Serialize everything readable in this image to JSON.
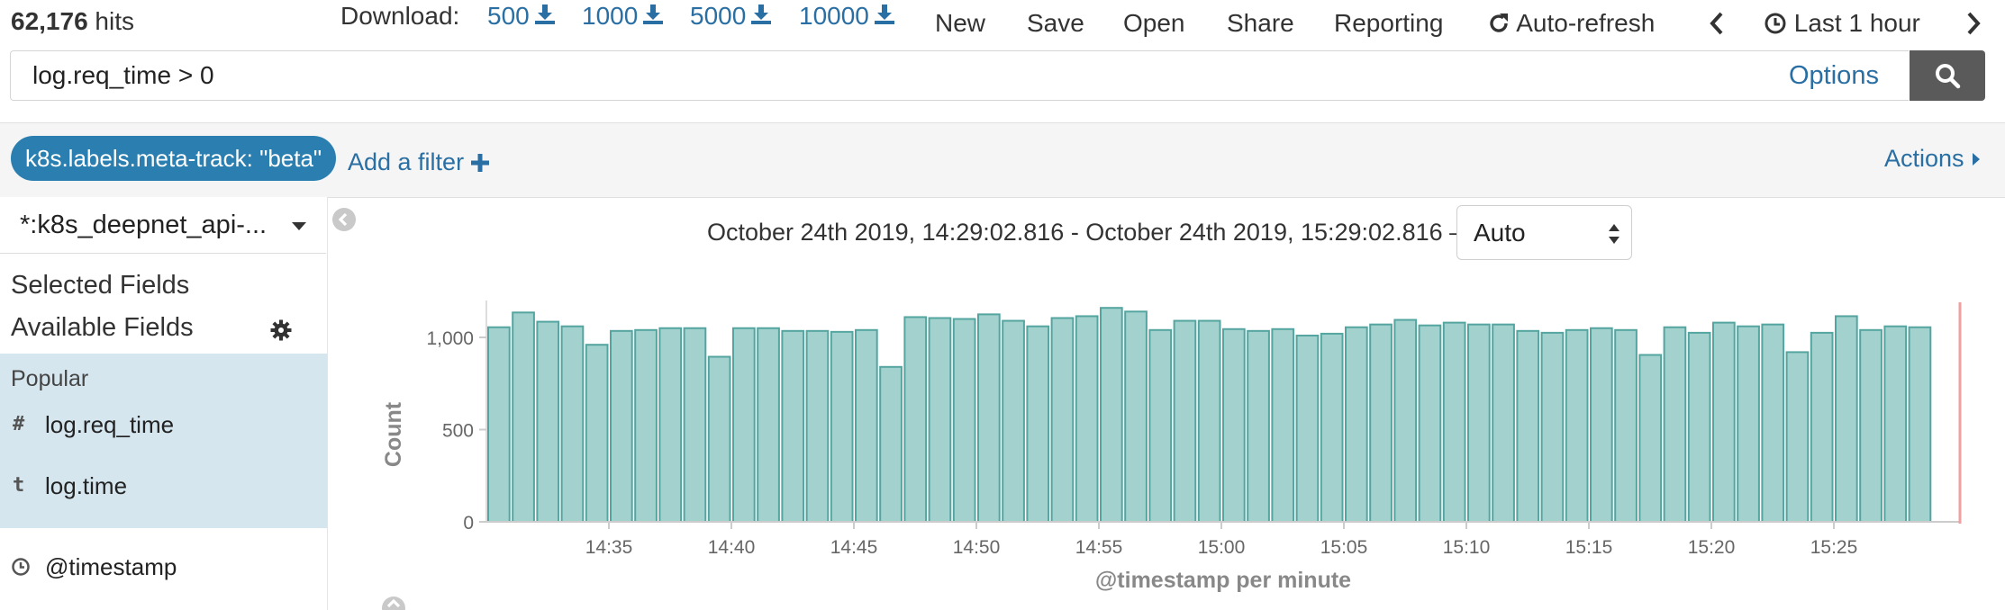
{
  "header": {
    "hits_count": "62,176",
    "hits_label": "hits",
    "download_label": "Download:",
    "download_options": [
      "500",
      "1000",
      "5000",
      "10000"
    ],
    "menu": {
      "new": "New",
      "save": "Save",
      "open": "Open",
      "share": "Share",
      "reporting": "Reporting",
      "auto_refresh": "Auto-refresh",
      "time_picker": "Last 1 hour"
    }
  },
  "query": {
    "value": "log.req_time > 0",
    "options_label": "Options"
  },
  "filters": {
    "active": [
      "k8s.labels.meta-track: \"beta\""
    ],
    "add_label": "Add a filter",
    "actions_label": "Actions"
  },
  "sidebar": {
    "index_pattern": "*:k8s_deepnet_api-...",
    "selected_fields_title": "Selected Fields",
    "available_fields_title": "Available Fields",
    "popular_label": "Popular",
    "popular_fields": [
      {
        "type": "#",
        "name": "log.req_time"
      },
      {
        "type": "t",
        "name": "log.time"
      }
    ],
    "other_fields": [
      {
        "type": "clock",
        "name": "@timestamp"
      }
    ]
  },
  "histogram": {
    "time_range": "October 24th 2019, 14:29:02.816 - October 24th 2019, 15:29:02.816 —",
    "interval": "Auto"
  },
  "colors": {
    "bar_fill": "#a3d2ce",
    "bar_stroke": "#54a5a0",
    "link": "#2a6fa3",
    "filter_pill": "#2a7fb0",
    "popular_bg": "#d5e6ef",
    "now_marker": "#f0a0a0"
  },
  "chart_data": {
    "type": "bar",
    "xlabel": "@timestamp per minute",
    "ylabel": "Count",
    "ylim": [
      0,
      1200
    ],
    "yticks": [
      "0",
      "500",
      "1,000"
    ],
    "xticks": [
      "14:35",
      "14:40",
      "14:45",
      "14:50",
      "14:55",
      "15:00",
      "15:05",
      "15:10",
      "15:15",
      "15:20",
      "15:25"
    ],
    "x": [
      "14:30",
      "14:31",
      "14:32",
      "14:33",
      "14:34",
      "14:35",
      "14:36",
      "14:37",
      "14:38",
      "14:39",
      "14:40",
      "14:41",
      "14:42",
      "14:43",
      "14:44",
      "14:45",
      "14:46",
      "14:47",
      "14:48",
      "14:49",
      "14:50",
      "14:51",
      "14:52",
      "14:53",
      "14:54",
      "14:55",
      "14:56",
      "14:57",
      "14:58",
      "14:59",
      "15:00",
      "15:01",
      "15:02",
      "15:03",
      "15:04",
      "15:05",
      "15:06",
      "15:07",
      "15:08",
      "15:09",
      "15:10",
      "15:11",
      "15:12",
      "15:13",
      "15:14",
      "15:15",
      "15:16",
      "15:17",
      "15:18",
      "15:19",
      "15:20",
      "15:21",
      "15:22",
      "15:23",
      "15:24",
      "15:25",
      "15:26",
      "15:27",
      "15:28"
    ],
    "values": [
      1055,
      1135,
      1085,
      1060,
      960,
      1035,
      1040,
      1050,
      1050,
      895,
      1050,
      1050,
      1035,
      1035,
      1030,
      1040,
      840,
      1110,
      1105,
      1100,
      1125,
      1090,
      1060,
      1105,
      1115,
      1160,
      1140,
      1040,
      1090,
      1090,
      1045,
      1035,
      1045,
      1010,
      1020,
      1055,
      1070,
      1095,
      1065,
      1080,
      1070,
      1070,
      1035,
      1025,
      1040,
      1050,
      1040,
      905,
      1055,
      1025,
      1080,
      1060,
      1070,
      920,
      1025,
      1115,
      1040,
      1060,
      1055
    ]
  }
}
